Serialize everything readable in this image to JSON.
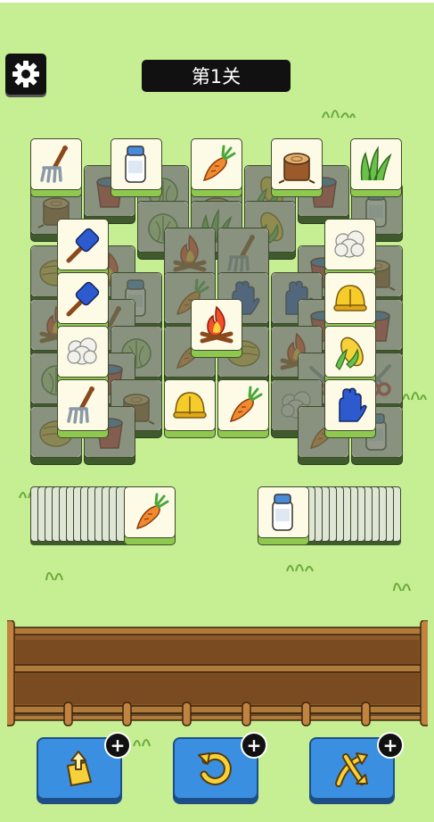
{
  "header": {
    "level_title": "第1关"
  },
  "icons": {
    "settings": "gear-icon",
    "tiles": [
      "rake-icon",
      "milk-bottle-icon",
      "carrot-icon",
      "tree-stump-icon",
      "grass-icon",
      "brush-icon",
      "cauliflower-icon",
      "bell-icon",
      "campfire-icon",
      "corn-icon",
      "glove-icon",
      "shears-icon",
      "bucket-icon",
      "cabbage-icon",
      "hay-bale-icon"
    ]
  },
  "tile_stack_left_top": "carrot",
  "tile_stack_right_top": "milk-bottle",
  "tray": {
    "slots_filled": 0
  },
  "buttons": {
    "pop_out": {
      "icon": "tile-out-icon",
      "badge": "+"
    },
    "undo": {
      "icon": "undo-icon",
      "badge": "+"
    },
    "shuffle": {
      "icon": "shuffle-icon",
      "badge": "+"
    }
  },
  "colors": {
    "background": "#c6ee93",
    "tile_face": "#fdfbe6",
    "tile_side": "#8fc84e",
    "button": "#3b8fe0",
    "tray_soil": "#8a5a2b"
  }
}
